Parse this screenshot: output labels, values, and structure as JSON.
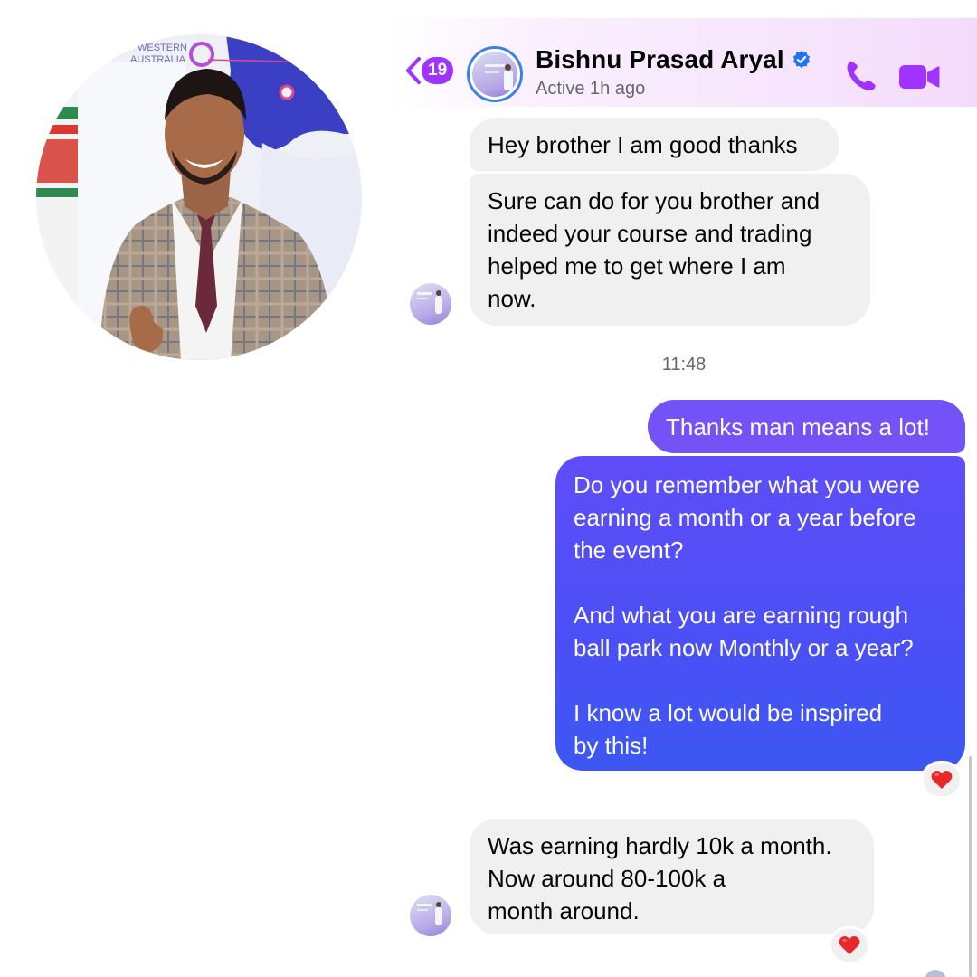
{
  "header": {
    "back_count": "19",
    "contact_name": "Bishnu Prasad Aryal",
    "status": "Active 1h ago",
    "icons": {
      "back": "chevron-left-icon",
      "verified": "verified-badge-icon",
      "call": "phone-icon",
      "video": "video-camera-icon"
    },
    "accent_color": "#a033ff"
  },
  "profile_photo": {
    "backdrop_text_line1": "WESTERN",
    "backdrop_text_line2": "AUSTRALIA"
  },
  "messages": [
    {
      "direction": "incoming",
      "text": "Hey brother I am good thanks"
    },
    {
      "direction": "incoming",
      "text": "Sure can do for you brother and\nindeed your course and trading\nhelped me to get where I am\nnow."
    },
    {
      "direction": "outgoing",
      "text": "Thanks man means a lot!"
    },
    {
      "direction": "outgoing",
      "text": "Do you remember what you were\nearning a month or a year before\nthe event?\n\nAnd what you are earning rough\nball park now Monthly or a year?\n\nI know a lot would be inspired\nby this!",
      "reaction": "❤️"
    },
    {
      "direction": "incoming",
      "text": "Was earning hardly 10k a month.\nNow around 80-100k a\nmonth around.",
      "reaction": "❤️"
    }
  ],
  "timestamp": "11:48",
  "colors": {
    "incoming_bubble": "#f0f0f0",
    "outgoing_bubble_top": "#5f4df8",
    "outgoing_bubble_bottom": "#3c57f2",
    "reaction_heart": "#e8272b"
  }
}
